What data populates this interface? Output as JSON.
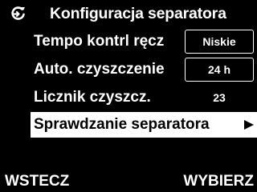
{
  "header": {
    "icon": "separator-settings-icon",
    "title": "Konfiguracja separatora"
  },
  "menu": {
    "items": [
      {
        "label": "Tempo kontrl ręcz",
        "value": "Niskie",
        "value_style": "box"
      },
      {
        "label": "Auto. czyszczenie",
        "value": "24 h",
        "value_style": "box"
      },
      {
        "label": "Licznik czyszcz.",
        "value": "23",
        "value_style": "plain"
      },
      {
        "label": "Sprawdzanie separatora",
        "selected": true,
        "icon": "arrow-right-icon"
      }
    ]
  },
  "softkeys": {
    "left": "WSTECZ",
    "right": "WYBIERZ"
  },
  "colors": {
    "background": "#000000",
    "foreground": "#ffffff",
    "selected_bg": "#ffffff",
    "selected_fg": "#000000"
  }
}
